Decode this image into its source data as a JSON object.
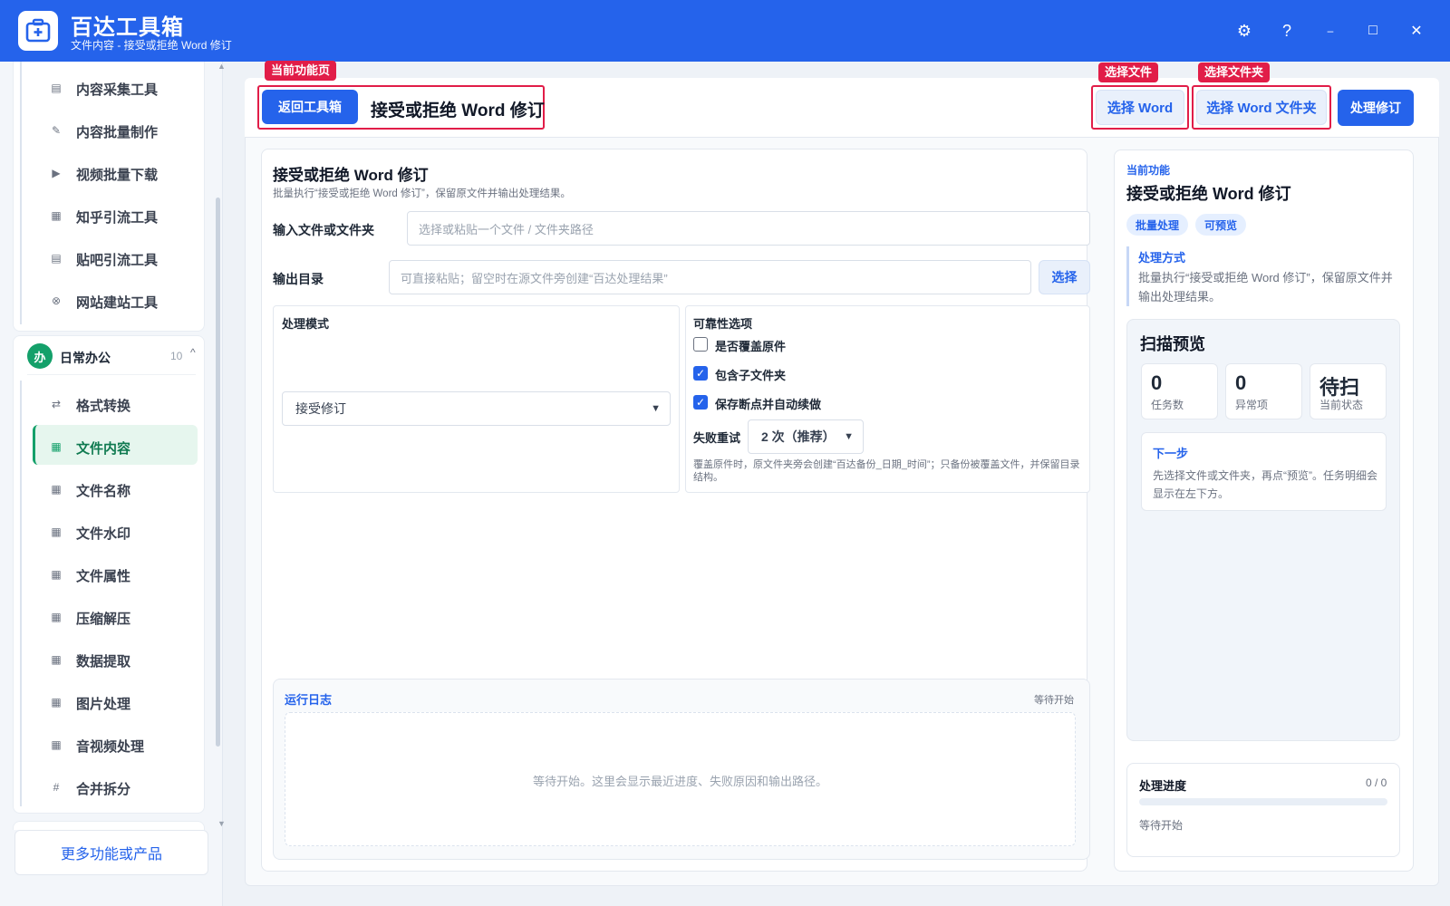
{
  "app": {
    "title": "百达工具箱",
    "subtitle": "文件内容 - 接受或拒绝 Word 修订"
  },
  "window_controls": {
    "settings": "⚙",
    "help": "?",
    "minimize": "–",
    "maximize": "□",
    "close": "✕"
  },
  "sidebar": {
    "top_items": [
      {
        "label": "内容采集工具",
        "icon": "collect-icon",
        "glyph": "▤"
      },
      {
        "label": "内容批量制作",
        "icon": "pen-icon",
        "glyph": "✎"
      },
      {
        "label": "视频批量下载",
        "icon": "video-icon",
        "glyph": "▶"
      },
      {
        "label": "知乎引流工具",
        "icon": "zhihu-icon",
        "glyph": "▦"
      },
      {
        "label": "贴吧引流工具",
        "icon": "tieba-icon",
        "glyph": "▤"
      },
      {
        "label": "网站建站工具",
        "icon": "web-icon",
        "glyph": "⊗"
      }
    ],
    "group": {
      "badge": "办",
      "name": "日常办公",
      "count": "10",
      "chevron": "^"
    },
    "group_items": [
      {
        "label": "格式转换",
        "icon": "convert-icon",
        "glyph": "⇄"
      },
      {
        "label": "文件内容",
        "icon": "grid-icon",
        "glyph": "▦"
      },
      {
        "label": "文件名称",
        "icon": "grid-icon",
        "glyph": "▦"
      },
      {
        "label": "文件水印",
        "icon": "grid-icon",
        "glyph": "▦"
      },
      {
        "label": "文件属性",
        "icon": "grid-icon",
        "glyph": "▦"
      },
      {
        "label": "压缩解压",
        "icon": "grid-icon",
        "glyph": "▦"
      },
      {
        "label": "数据提取",
        "icon": "grid-icon",
        "glyph": "▦"
      },
      {
        "label": "图片处理",
        "icon": "grid-icon",
        "glyph": "▦"
      },
      {
        "label": "音视频处理",
        "icon": "grid-icon",
        "glyph": "▦"
      },
      {
        "label": "合并拆分",
        "icon": "hash-icon",
        "glyph": "#"
      }
    ],
    "more": "更多功能或产品"
  },
  "toolbar": {
    "back": "返回工具箱",
    "title": "接受或拒绝 Word 修订",
    "select_word": "选择 Word",
    "select_folder": "选择 Word 文件夹",
    "process": "处理修订",
    "tag_current": "当前功能页",
    "tag_file": "选择文件",
    "tag_folder": "选择文件夹"
  },
  "form": {
    "title": "接受或拒绝 Word 修订",
    "desc": "批量执行“接受或拒绝 Word 修订”，保留原文件并输出处理结果。",
    "input_label": "输入文件或文件夹",
    "input_placeholder": "选择或粘贴一个文件 / 文件夹路径",
    "output_label": "输出目录",
    "output_placeholder": "可直接粘贴；留空时在源文件旁创建“百达处理结果”",
    "output_button": "选择",
    "mode_label": "处理模式",
    "mode_value": "接受修订",
    "reliability_label": "可靠性选项",
    "opt_overwrite": "是否覆盖原件",
    "opt_subfolders": "包含子文件夹",
    "opt_resume": "保存断点并自动续做",
    "retry_label": "失败重试",
    "retry_value": "2 次（推荐）",
    "note": "覆盖原件时，原文件夹旁会创建“百达备份_日期_时间”；只备份被覆盖文件，并保留目录结构。"
  },
  "log": {
    "title": "运行日志",
    "status": "等待开始",
    "empty": "等待开始。这里会显示最近进度、失败原因和输出路径。"
  },
  "right": {
    "section": "当前功能",
    "title": "接受或拒绝 Word 修订",
    "chips": [
      "批量处理",
      "可预览"
    ],
    "method_title": "处理方式",
    "method_desc": "批量执行“接受或拒绝 Word 修订”，保留原文件并输出处理结果。",
    "scan_title": "扫描预览",
    "stats": [
      {
        "value": "0",
        "label": "任务数"
      },
      {
        "value": "0",
        "label": "异常项"
      },
      {
        "value": "待扫",
        "label": "当前状态"
      }
    ],
    "next_title": "下一步",
    "next_desc": "先选择文件或文件夹，再点“预览”。任务明细会显示在左下方。",
    "progress_title": "处理进度",
    "progress_count": "0 / 0",
    "progress_fraction": 0,
    "progress_status": "等待开始"
  },
  "colors": {
    "brand": "#2563eb",
    "accent_green": "#14a06a",
    "annotation_red": "#e11d48"
  }
}
